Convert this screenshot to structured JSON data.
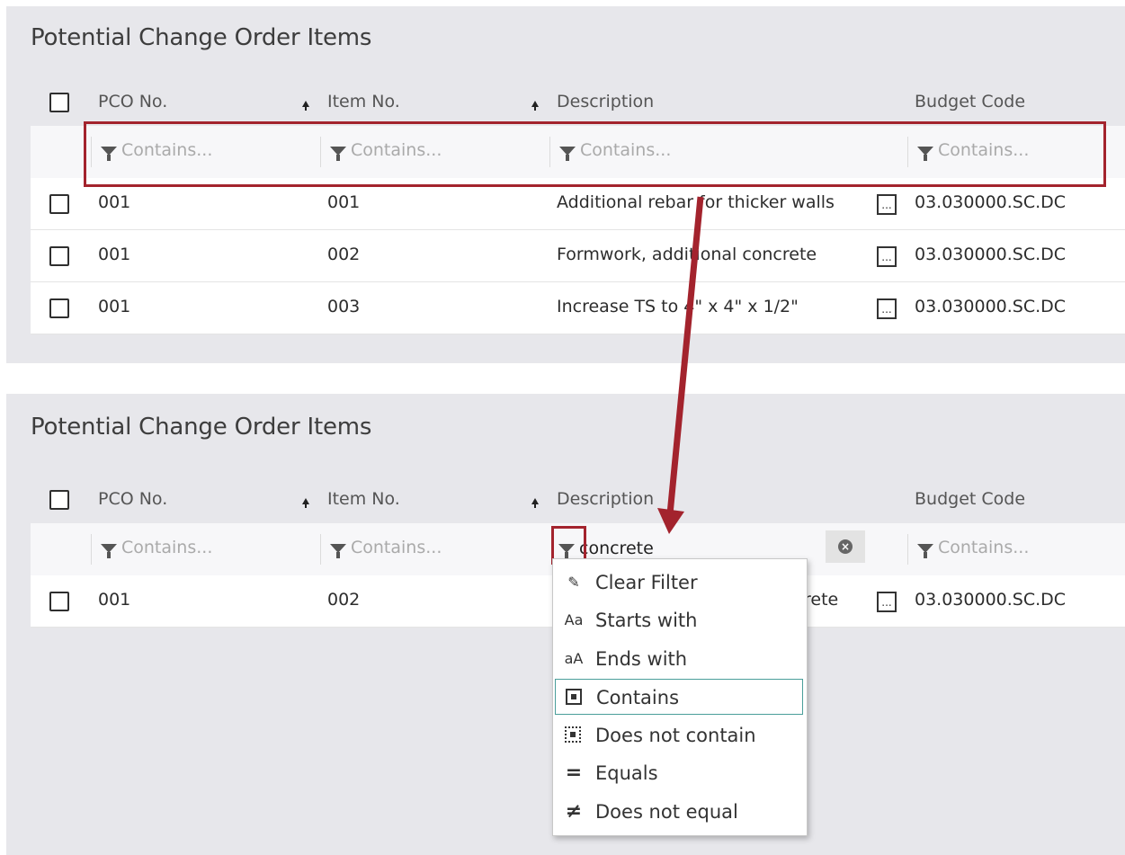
{
  "panels": [
    {
      "title": "Potential Change Order Items",
      "columns": {
        "pco": "PCO No.",
        "item": "Item No.",
        "desc": "Description",
        "budget": "Budget Code"
      },
      "filters": {
        "pco": "Contains...",
        "item": "Contains...",
        "desc": "Contains...",
        "budget": "Contains..."
      },
      "rows": [
        {
          "pco": "001",
          "item": "001",
          "desc": "Additional rebar for thicker walls",
          "ellipsis": "...",
          "budget": "03.030000.SC.DC"
        },
        {
          "pco": "001",
          "item": "002",
          "desc": "Formwork, additional concrete",
          "ellipsis": "...",
          "budget": "03.030000.SC.DC"
        },
        {
          "pco": "001",
          "item": "003",
          "desc": "Increase TS to 4\" x 4\" x 1/2\"",
          "ellipsis": "...",
          "budget": "03.030000.SC.DC"
        }
      ]
    },
    {
      "title": "Potential Change Order Items",
      "columns": {
        "pco": "PCO No.",
        "item": "Item No.",
        "desc": "Description",
        "budget": "Budget Code"
      },
      "filters": {
        "pco": "Contains...",
        "item": "Contains...",
        "desc_value": "concrete",
        "budget": "Contains..."
      },
      "rows": [
        {
          "pco": "001",
          "item": "002",
          "desc_visible": "rete",
          "ellipsis": "...",
          "budget": "03.030000.SC.DC"
        }
      ]
    }
  ],
  "filter_menu": {
    "items": [
      {
        "icon": "eraser-icon",
        "glyph": "✎",
        "label": "Clear Filter"
      },
      {
        "icon": "starts-with-icon",
        "glyph": "Aa",
        "label": "Starts with"
      },
      {
        "icon": "ends-with-icon",
        "glyph": "aA",
        "label": "Ends with"
      },
      {
        "icon": "contains-icon",
        "glyph": "",
        "label": "Contains",
        "selected": true
      },
      {
        "icon": "does-not-contain-icon",
        "glyph": "",
        "label": "Does not contain"
      },
      {
        "icon": "equals-icon",
        "glyph": "=",
        "label": "Equals"
      },
      {
        "icon": "not-equal-icon",
        "glyph": "≠",
        "label": "Does not equal"
      }
    ]
  },
  "colors": {
    "annotation": "#a3232d",
    "selected_border": "#4a9e9a",
    "panel_bg": "#e7e7eb"
  }
}
